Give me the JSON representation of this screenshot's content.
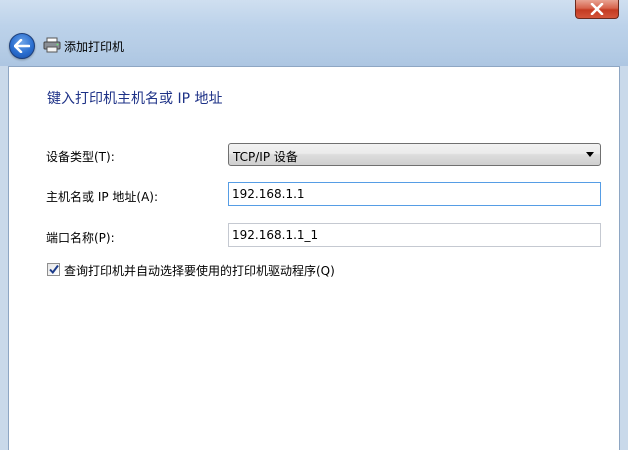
{
  "window": {
    "title": "添加打印机"
  },
  "form": {
    "heading": "键入打印机主机名或 IP 地址",
    "device_type_label": "设备类型(T):",
    "device_type_value": "TCP/IP 设备",
    "host_label": "主机名或 IP 地址(A):",
    "host_value": "192.168.1.1",
    "port_label": "端口名称(P):",
    "port_value": "192.168.1.1_1",
    "query_label": "查询打印机并自动选择要使用的打印机驱动程序(Q)",
    "query_checked": true
  },
  "icons": {
    "back": "back-arrow-icon",
    "printer": "printer-icon",
    "close": "close-icon",
    "dropdown": "chevron-down-icon",
    "check": "checkmark-icon"
  },
  "colors": {
    "heading": "#1e3287",
    "close_button": "#c43b22",
    "back_button": "#2b6fd0",
    "focus_border": "#569de5"
  }
}
